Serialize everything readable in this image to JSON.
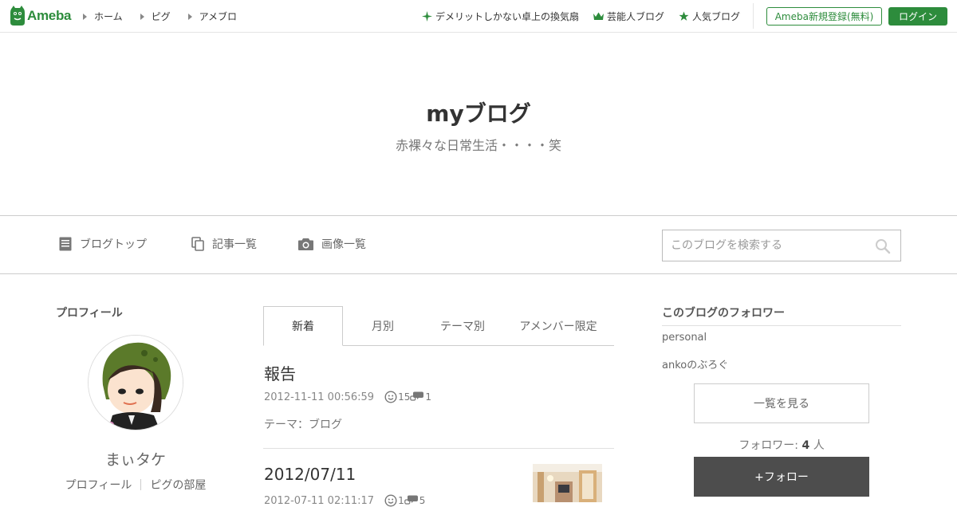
{
  "topbar": {
    "logo_text": "Ameba",
    "nav": [
      {
        "label": "ホーム"
      },
      {
        "label": "ピグ"
      },
      {
        "label": "アメブロ"
      }
    ],
    "links": [
      {
        "label": "デメリットしかない卓上の換気扇",
        "icon": "sparkle-icon"
      },
      {
        "label": "芸能人ブログ",
        "icon": "crown-icon"
      },
      {
        "label": "人気ブログ",
        "icon": "star-icon"
      }
    ],
    "register_label": "Ameba新規登録(無料)",
    "login_label": "ログイン",
    "brand_color": "#2d8c3c"
  },
  "header": {
    "title": "myブログ",
    "description": "赤裸々な日常生活・・・・笑"
  },
  "subnav": {
    "items": [
      {
        "label": "ブログトップ",
        "icon": "document-icon"
      },
      {
        "label": "記事一覧",
        "icon": "copy-icon"
      },
      {
        "label": "画像一覧",
        "icon": "camera-icon"
      }
    ],
    "search_placeholder": "このブログを検索する"
  },
  "profile": {
    "heading": "プロフィール",
    "name": "まぃタケ",
    "links": [
      "プロフィール",
      "ピグの部屋"
    ]
  },
  "tabs": [
    {
      "label": "新着",
      "active": true
    },
    {
      "label": "月別",
      "active": false
    },
    {
      "label": "テーマ別",
      "active": false
    },
    {
      "label": "アメンバー限定",
      "active": false
    }
  ],
  "entries": [
    {
      "title": "報告",
      "datetime": "2012-11-11 00:56:59",
      "likes": "15",
      "comments": "1",
      "theme": "テーマ：ブログ"
    },
    {
      "title": "2012/07/11",
      "datetime": "2012-07-11 02:11:17",
      "likes": "1",
      "comments": "5"
    }
  ],
  "followers": {
    "heading": "このブログのフォロワー",
    "names": [
      "personal",
      "ankoのぶろぐ"
    ],
    "list_button": "一覧を見る",
    "count_label": "フォロワー:",
    "count": "4",
    "count_unit": "人",
    "follow_button": "+フォロー"
  }
}
